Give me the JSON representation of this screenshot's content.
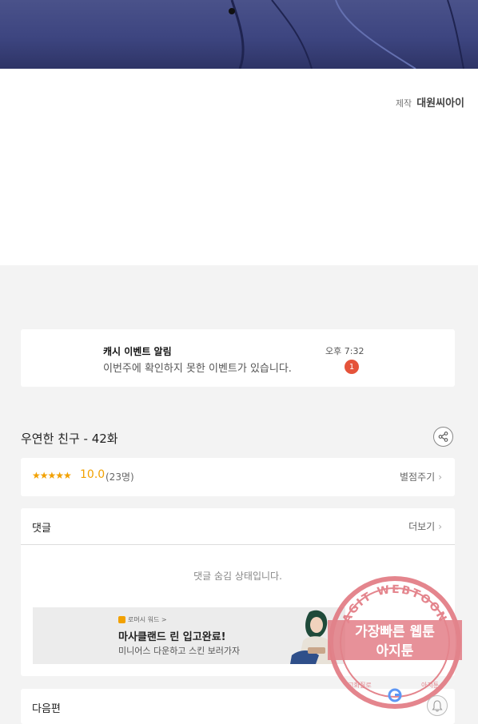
{
  "credit": {
    "label": "제작",
    "studio": "대원씨아이"
  },
  "notification": {
    "title": "캐시 이벤트 알림",
    "message": "이번주에 확인하지 못한 이벤트가 있습니다.",
    "time": "오후 7:32",
    "badge_count": "1"
  },
  "episode": {
    "title": "우연한 친구 - 42화"
  },
  "rating": {
    "stars": "★★★★★",
    "score": "10.0",
    "count": "(23명)",
    "rate_label": "별점주기"
  },
  "comments": {
    "header": "댓글",
    "more_label": "더보기",
    "hidden_message": "댓글 숨김 상태입니다."
  },
  "ad": {
    "brand": "로머시 워드 >",
    "headline": "마사클랜드 린 입고완료!",
    "subtext": "미니어스 다운하고 스킨 보러가자"
  },
  "next": {
    "label": "다음편"
  },
  "watermark": {
    "arc_text": "AGIT WEBTOON",
    "line1": "가장빠른 웹툰",
    "line2": "아지툰",
    "bottom_left": "고화질로",
    "bottom_right": "아지툰"
  },
  "colors": {
    "accent": "#f2a100",
    "badge": "#e5533a",
    "watermark": "#e0707a"
  }
}
